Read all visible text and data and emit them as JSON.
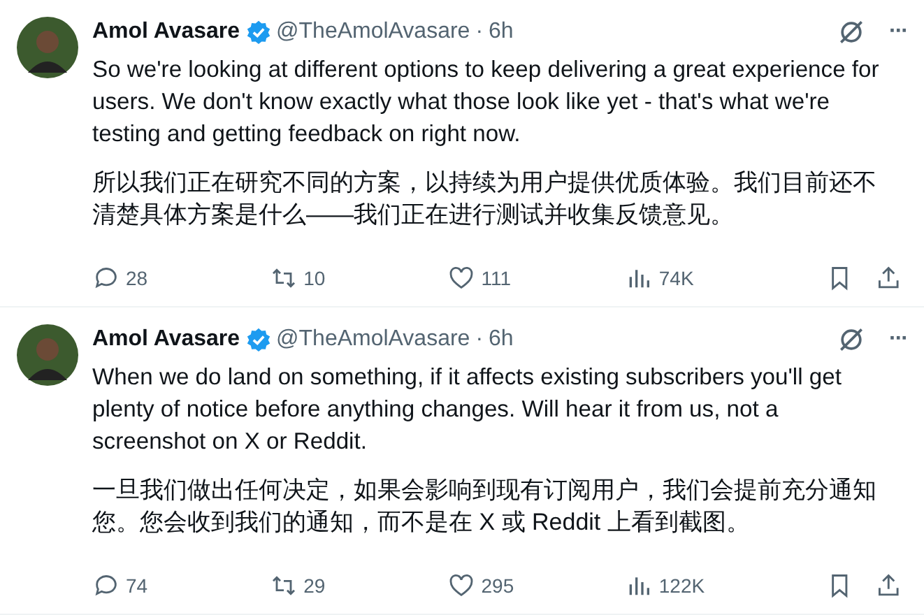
{
  "tweets": [
    {
      "name": "Amol Avasare",
      "verified": true,
      "handle": "@TheAmolAvasare",
      "separator": "·",
      "time": "6h",
      "more": "···",
      "text": "So we're looking at different options to keep delivering a great experience for users. We don't know exactly what those look like yet - that's what we're testing and getting feedback on right now.",
      "translation": "所以我们正在研究不同的方案，以持续为用户提供优质体验。我们目前还不清楚具体方案是什么——我们正在进行测试并收集反馈意见。",
      "replies": "28",
      "reposts": "10",
      "likes": "111",
      "views": "74K"
    },
    {
      "name": "Amol Avasare",
      "verified": true,
      "handle": "@TheAmolAvasare",
      "separator": "·",
      "time": "6h",
      "more": "···",
      "text": "When we do land on something, if it affects existing subscribers you'll get plenty of notice before anything changes. Will hear it from us, not a screenshot on X or Reddit.",
      "translation": "一旦我们做出任何决定，如果会影响到现有订阅用户，我们会提前充分通知您。您会收到我们的通知，而不是在 X 或 Reddit 上看到截图。",
      "replies": "74",
      "reposts": "29",
      "likes": "295",
      "views": "122K"
    }
  ]
}
